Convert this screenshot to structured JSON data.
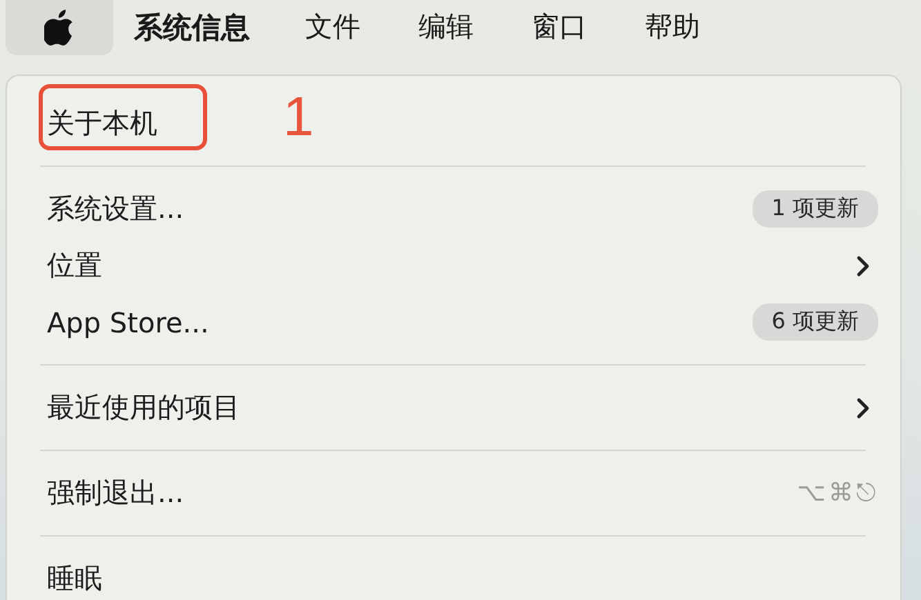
{
  "menubar": {
    "apple_menu_open": true,
    "items": [
      {
        "label": "系统信息",
        "kind": "app"
      },
      {
        "label": "文件",
        "kind": "menu"
      },
      {
        "label": "编辑",
        "kind": "menu"
      },
      {
        "label": "窗口",
        "kind": "menu"
      },
      {
        "label": "帮助",
        "kind": "menu"
      }
    ]
  },
  "menu": {
    "items": [
      {
        "kind": "item",
        "label": "关于本机",
        "annotation": "1"
      },
      {
        "kind": "separator"
      },
      {
        "kind": "badge",
        "label": "系统设置...",
        "badge": "1 项更新"
      },
      {
        "kind": "submenu",
        "label": "位置"
      },
      {
        "kind": "badge",
        "label": "App Store...",
        "badge": "6 项更新"
      },
      {
        "kind": "separator"
      },
      {
        "kind": "submenu",
        "label": "最近使用的项目"
      },
      {
        "kind": "separator"
      },
      {
        "kind": "shortcut",
        "label": "强制退出...",
        "shortcut": "⌥⌘⎋"
      },
      {
        "kind": "separator"
      },
      {
        "kind": "item",
        "label": "睡眠"
      }
    ]
  }
}
